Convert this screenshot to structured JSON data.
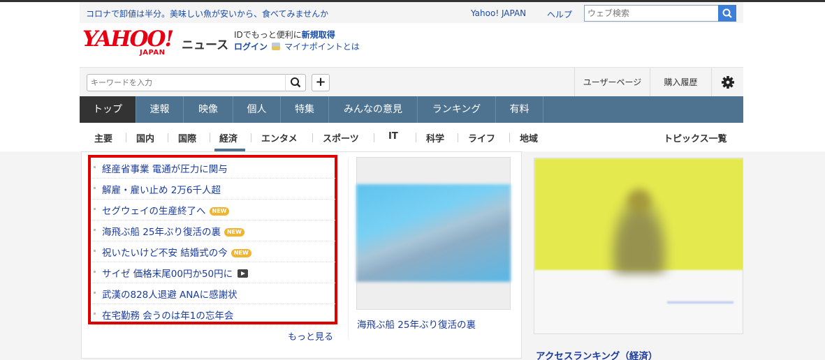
{
  "header": {
    "promo": "コロナで卸値は半分。美味しい魚が安いから、食べてみませんか",
    "yahoo_japan": "Yahoo! JAPAN",
    "help": "ヘルプ",
    "web_search_placeholder": "ウェブ検索"
  },
  "logo": {
    "yahoo": "YAHOO!",
    "japan": "JAPAN",
    "service": "ニュース"
  },
  "account": {
    "line1_prefix": "IDでもっと便利に",
    "register": "新規取得",
    "login": "ログイン",
    "mypoint": "マイナポイントとは"
  },
  "toolbar": {
    "keyword_placeholder": "キーワードを入力",
    "plus": "+",
    "user_page": "ユーザーページ",
    "history": "購入履歴"
  },
  "main_nav": [
    {
      "label": "トップ",
      "active": true
    },
    {
      "label": "速報",
      "active": false
    },
    {
      "label": "映像",
      "active": false
    },
    {
      "label": "個人",
      "active": false
    },
    {
      "label": "特集",
      "active": false
    },
    {
      "label": "みんなの意見",
      "active": false
    },
    {
      "label": "ランキング",
      "active": false
    },
    {
      "label": "有料",
      "active": false
    }
  ],
  "sub_nav": {
    "items": [
      "主要",
      "国内",
      "国際",
      "経済",
      "エンタメ",
      "スポーツ",
      "IT",
      "科学",
      "ライフ",
      "地域"
    ],
    "active": "経済",
    "topics_all": "トピックス一覧"
  },
  "news": {
    "items": [
      {
        "title": "経産省事業 電通が圧力に関与",
        "badge": "",
        "video": false
      },
      {
        "title": "解雇・雇い止め 2万6千人超",
        "badge": "",
        "video": false
      },
      {
        "title": "セグウェイの生産終了へ",
        "badge": "NEW",
        "video": false
      },
      {
        "title": "海飛ぶ船 25年ぶり復活の裏",
        "badge": "NEW",
        "video": false
      },
      {
        "title": "祝いたいけど不安 結婚式の今",
        "badge": "NEW",
        "video": false
      },
      {
        "title": "サイゼ 価格末尾00円か50円に",
        "badge": "",
        "video": true
      },
      {
        "title": "武漢の828人退避 ANAに感謝状",
        "badge": "",
        "video": false
      },
      {
        "title": "在宅勤務 会うのは年1の忘年会",
        "badge": "",
        "video": false
      }
    ],
    "more": "もっと見る",
    "photo_caption": "海飛ぶ船 25年ぶり復活の裏"
  },
  "sidebar": {
    "access_ranking": "アクセスランキング（経済）"
  }
}
